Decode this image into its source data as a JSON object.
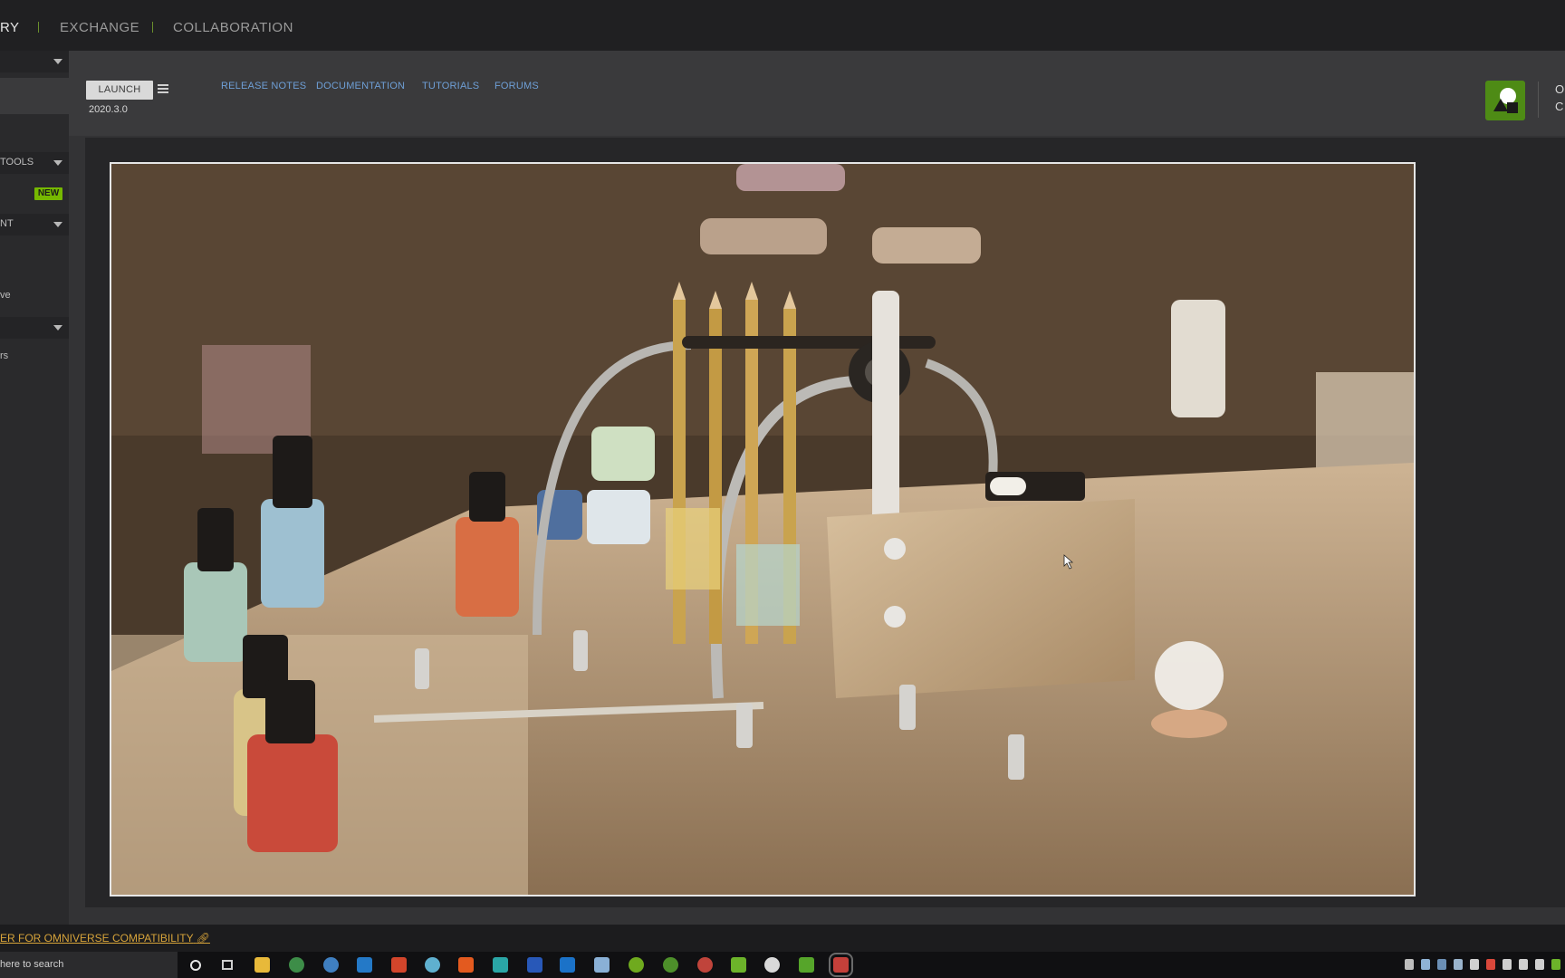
{
  "topnav": {
    "tabs": [
      {
        "label": "RY",
        "active": true
      },
      {
        "label": "EXCHANGE",
        "active": false
      },
      {
        "label": "COLLABORATION",
        "active": false
      }
    ]
  },
  "sidebar": {
    "section_tools": "TOOLS",
    "badge_new": "NEW",
    "section_content": "NT",
    "item_ve": "ve",
    "item_rs": "rs"
  },
  "header": {
    "launch_label": "LAUNCH",
    "version": "2020.3.0",
    "links": [
      "RELEASE NOTES",
      "DOCUMENTATION",
      "TUTORIALS",
      "FORUMS"
    ],
    "app_name_line1": "O",
    "app_name_line2": "C"
  },
  "bottom": {
    "compat_link": "ER FOR OMNIVERSE COMPATIBILITY"
  },
  "taskbar": {
    "search_placeholder": "here to search"
  },
  "colors": {
    "accent_green": "#76b900",
    "link_blue": "#6e9fd6",
    "link_orange": "#d6a33a"
  }
}
